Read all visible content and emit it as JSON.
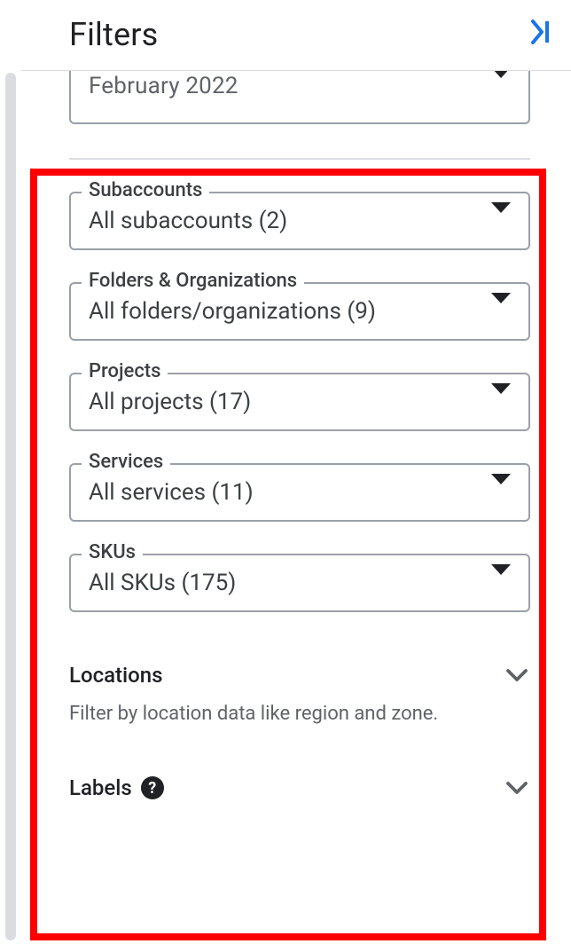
{
  "header": {
    "title": "Filters"
  },
  "dateFilter": {
    "value": "February 2022"
  },
  "filters": {
    "subaccounts": {
      "label": "Subaccounts",
      "value": "All subaccounts (2)"
    },
    "folders": {
      "label": "Folders & Organizations",
      "value": "All folders/organizations (9)"
    },
    "projects": {
      "label": "Projects",
      "value": "All projects (17)"
    },
    "services": {
      "label": "Services",
      "value": "All services (11)"
    },
    "skus": {
      "label": "SKUs",
      "value": "All SKUs (175)"
    }
  },
  "sections": {
    "locations": {
      "title": "Locations",
      "subtitle": "Filter by location data like region and zone."
    },
    "labels": {
      "title": "Labels"
    }
  }
}
